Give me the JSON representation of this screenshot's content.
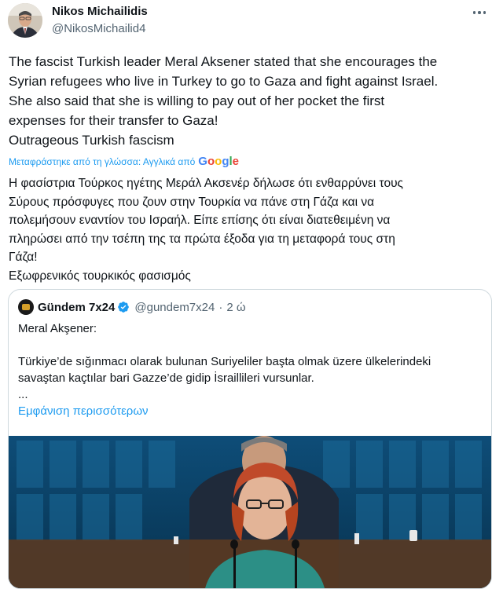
{
  "author": {
    "name": "Nikos Michailidis",
    "handle": "@NikosMichailid4"
  },
  "tweet": {
    "lines": [
      "The fascist Turkish leader Meral Aksener stated that she encourages the",
      "Syrian refugees who live in Turkey to go to Gaza and fight against Israel.",
      "She also said that she is willing to pay out of her pocket the first",
      "expenses for their transfer to Gaza!",
      "Outrageous Turkish fascism"
    ],
    "translated_label": "Μεταφράστηκε από τη γλώσσα: Αγγλικά από",
    "translation_provider": [
      "G",
      "o",
      "o",
      "g",
      "l",
      "e"
    ],
    "translation_lines": [
      "Η φασίστρια Τούρκος ηγέτης Μεράλ Ακσενέρ δήλωσε ότι ενθαρρύνει τους",
      "Σύρους πρόσφυγες που ζουν στην Τουρκία να πάνε στη Γάζα και να",
      "πολεμήσουν εναντίον του Ισραήλ. Είπε επίσης ότι είναι διατεθειμένη να",
      "πληρώσει από την τσέπη της τα πρώτα έξοδα για τη μεταφορά τους στη",
      "Γάζα!",
      "Εξωφρενικός τουρκικός φασισμός"
    ]
  },
  "quoted": {
    "name": "Gündem 7x24",
    "handle": "@gundem7x24",
    "dot": "·",
    "time": "2 ώ",
    "lines": [
      "Meral Akşener:",
      "",
      "Türkiye’de sığınmacı olarak bulunan Suriyeliler başta olmak üzere ülkelerindeki",
      "savaştan kaçtılar bari Gazze’de gidip İsraillileri vursunlar.",
      "..."
    ],
    "show_more": "Εμφάνιση περισσότερων"
  },
  "colors": {
    "link": "#1d9bf0",
    "secondary_text": "#536471",
    "border": "#cfd9de",
    "verified": "#1d9bf0"
  }
}
